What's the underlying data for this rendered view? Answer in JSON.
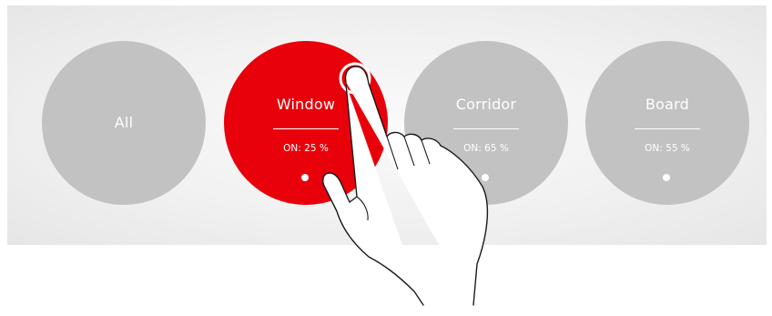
{
  "zones": [
    {
      "name": "All"
    },
    {
      "name": "Window",
      "status": "ON: 25 %",
      "active": true
    },
    {
      "name": "Corridor",
      "status": "ON: 65 %"
    },
    {
      "name": "Board",
      "status": "ON: 55 %"
    }
  ],
  "colors": {
    "active": "#e8000a",
    "inactive": "#c2c2c2",
    "text": "#ffffff"
  }
}
